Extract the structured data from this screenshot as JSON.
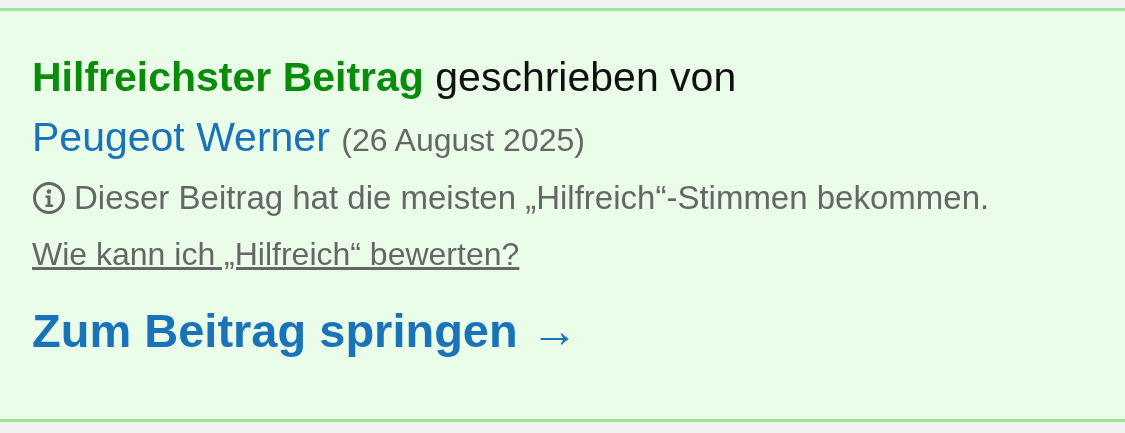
{
  "answer_box": {
    "label": "Hilfreichster Beitrag",
    "by_text": "geschrieben von",
    "author": "Peugeot Werner",
    "date": "(26 August 2025)",
    "note": "Dieser Beitrag hat die meisten „Hilfreich“-Stimmen bekommen.",
    "help_link": "Wie kann ich „Hilfreich“ bewerten?",
    "jump_link": {
      "label": "Zum Beitrag springen",
      "arrow": "→"
    }
  }
}
